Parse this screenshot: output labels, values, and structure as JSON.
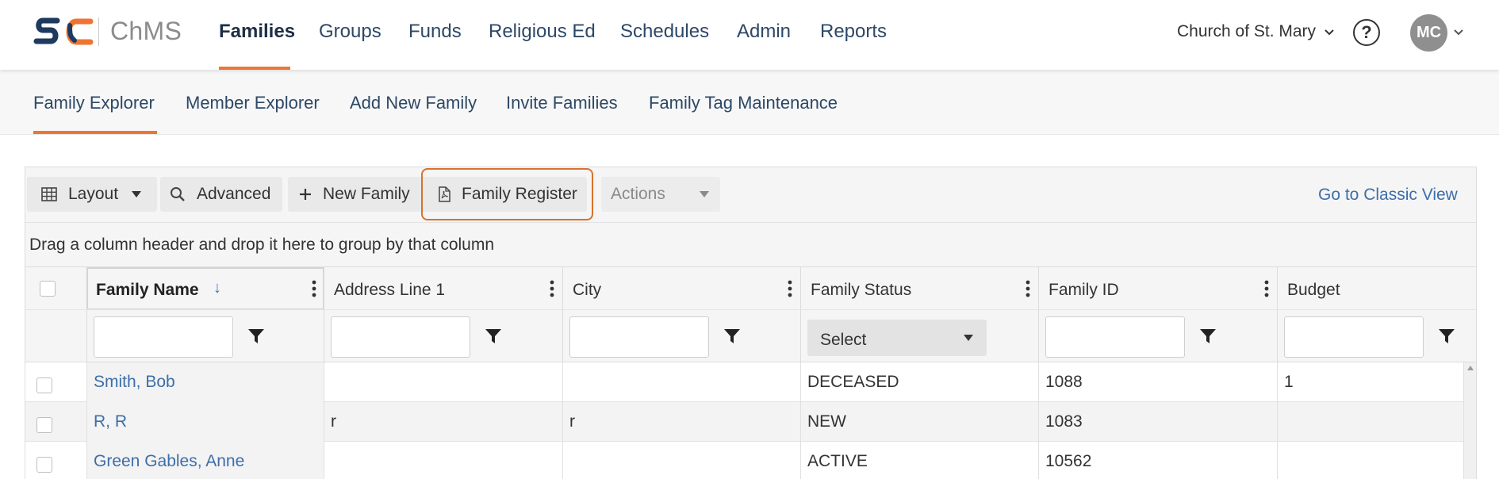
{
  "brand": {
    "name": "ChMS"
  },
  "nav": {
    "items": [
      {
        "label": "Families",
        "active": true
      },
      {
        "label": "Groups"
      },
      {
        "label": "Funds"
      },
      {
        "label": "Religious Ed"
      },
      {
        "label": "Schedules"
      },
      {
        "label": "Admin"
      },
      {
        "label": "Reports"
      }
    ],
    "organization": "Church of St. Mary",
    "help_symbol": "?",
    "user_initials": "MC"
  },
  "subnav": {
    "items": [
      {
        "label": "Family Explorer",
        "active": true
      },
      {
        "label": "Member Explorer"
      },
      {
        "label": "Add New Family"
      },
      {
        "label": "Invite Families"
      },
      {
        "label": "Family Tag Maintenance"
      }
    ]
  },
  "toolbar": {
    "layout_label": "Layout",
    "advanced_label": "Advanced",
    "new_family_label": "New Family",
    "family_register_label": "Family Register",
    "actions_label": "Actions",
    "classic_view_label": "Go to Classic View"
  },
  "grid": {
    "group_hint": "Drag a column header and drop it here to group by that column",
    "columns": [
      "Family Name",
      "Address Line 1",
      "City",
      "Family Status",
      "Family ID",
      "Budget"
    ],
    "status_filter_placeholder": "Select",
    "rows": [
      {
        "family_name": "Smith, Bob",
        "address": "",
        "city": "",
        "status": "DECEASED",
        "family_id": "1088",
        "budget": "1"
      },
      {
        "family_name": "R, R",
        "address": "r",
        "city": "r",
        "status": "NEW",
        "family_id": "1083",
        "budget": ""
      },
      {
        "family_name": "Green Gables, Anne",
        "address": "",
        "city": "",
        "status": "ACTIVE",
        "family_id": "10562",
        "budget": ""
      }
    ]
  },
  "colors": {
    "accent": "#ee7531",
    "nav_text": "#2d4866",
    "link": "#3e6ea8",
    "highlight_border": "#d7722e"
  }
}
